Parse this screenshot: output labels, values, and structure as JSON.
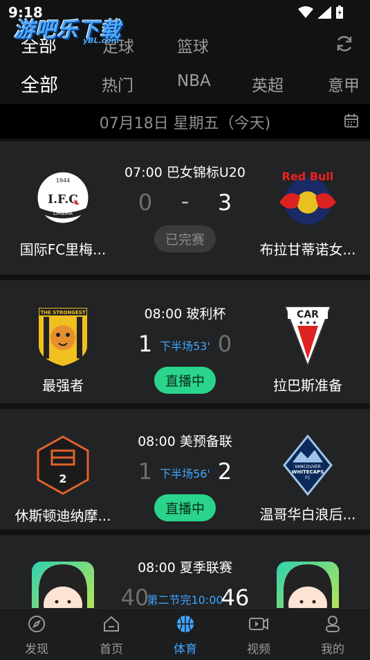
{
  "status_bar": {
    "time": "9:18"
  },
  "watermark": {
    "main": "游吧乐下载",
    "sub": "yBL.com"
  },
  "top_tabs": [
    {
      "label": "全部",
      "active": true
    },
    {
      "label": "足球",
      "active": false
    },
    {
      "label": "篮球",
      "active": false
    }
  ],
  "sub_tabs": [
    {
      "label": "全部",
      "active": true
    },
    {
      "label": "热门",
      "active": false
    },
    {
      "label": "NBA",
      "active": false
    },
    {
      "label": "英超",
      "active": false
    },
    {
      "label": "意甲",
      "active": false
    }
  ],
  "date_bar": {
    "date": "07月18日 星期五（今天)"
  },
  "matches": [
    {
      "time_league": "07:00 巴女锦标U20",
      "home": {
        "name": "国际FC里梅...",
        "score": "0"
      },
      "away": {
        "name": "布拉甘蒂诺女...",
        "score": "3"
      },
      "status": "已完赛",
      "separator": "-"
    },
    {
      "time_league": "08:00 玻利杯",
      "home": {
        "name": "最强者",
        "score": "1"
      },
      "away": {
        "name": "拉巴斯准备",
        "score": "0"
      },
      "minute": "下半场53'",
      "status": "直播中"
    },
    {
      "time_league": "08:00 美预备联",
      "home": {
        "name": "休斯顿迪纳摩...",
        "score": "1"
      },
      "away": {
        "name": "温哥华白浪后...",
        "score": "2"
      },
      "minute": "下半场56'",
      "status": "直播中"
    },
    {
      "time_league": "08:00 夏季联赛",
      "home": {
        "name": "",
        "score": "40"
      },
      "away": {
        "name": "",
        "score": "46"
      },
      "minute": "第二节完10:00"
    }
  ],
  "logos": {
    "limeira_text": "I.F.C",
    "limeira_sub": "LIMEIRA",
    "limeira_year": "1944",
    "redbull_text": "Red Bull",
    "strongest_text": "THE STRONGEST",
    "car_text": "CAR",
    "houston_number": "2",
    "vancouver_text1": "VANCOUVER",
    "vancouver_text2": "WHITECAPS",
    "vancouver_text3": "FC"
  },
  "bottom_nav": [
    {
      "label": "发现",
      "icon": "compass-icon",
      "active": false
    },
    {
      "label": "首页",
      "icon": "home-icon",
      "active": false
    },
    {
      "label": "体育",
      "icon": "basketball-icon",
      "active": true
    },
    {
      "label": "视频",
      "icon": "video-icon",
      "active": false
    },
    {
      "label": "我的",
      "icon": "profile-icon",
      "active": false
    }
  ],
  "colors": {
    "live": "#2ad48a",
    "minute": "#3fa6ff",
    "background": "#111213",
    "card": "#222325"
  }
}
